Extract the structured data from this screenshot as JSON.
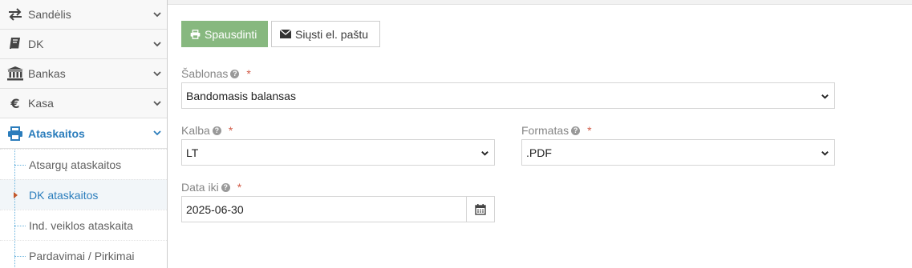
{
  "sidebar": {
    "items": [
      {
        "label": "Sandėlis",
        "icon": "exchange-icon"
      },
      {
        "label": "DK",
        "icon": "book-icon"
      },
      {
        "label": "Bankas",
        "icon": "bank-icon"
      },
      {
        "label": "Kasa",
        "icon": "euro-icon"
      },
      {
        "label": "Ataskaitos",
        "icon": "print-icon",
        "active": true
      }
    ],
    "subitems": [
      {
        "label": "Atsargų ataskaitos"
      },
      {
        "label": "DK ataskaitos",
        "active": true
      },
      {
        "label": "Ind. veiklos ataskaita"
      },
      {
        "label": "Pardavimai / Pirkimai"
      }
    ]
  },
  "toolbar": {
    "print_label": "Spausdinti",
    "email_label": "Siųsti el. paštu"
  },
  "form": {
    "template": {
      "label": "Šablonas",
      "value": "Bandomasis balansas",
      "required": "*"
    },
    "language": {
      "label": "Kalba",
      "value": "LT",
      "required": "*"
    },
    "format": {
      "label": "Formatas",
      "value": ".PDF",
      "required": "*"
    },
    "date": {
      "label": "Data iki",
      "value": "2025-06-30",
      "required": "*"
    }
  },
  "colors": {
    "accent": "#2b7dbc",
    "print_button": "#87b87f",
    "required": "#d15b47"
  }
}
